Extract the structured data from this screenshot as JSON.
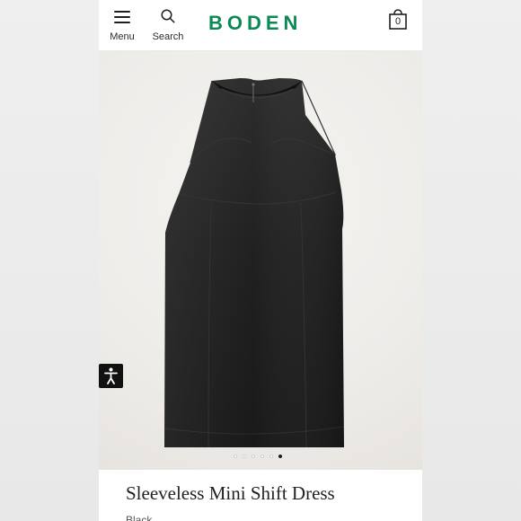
{
  "header": {
    "menu_label": "Menu",
    "search_label": "Search",
    "logo_text": "BODEN",
    "bag_count": "0",
    "brand_color": "#0c8a55"
  },
  "carousel": {
    "dot_count": 6,
    "active_index": 5
  },
  "product": {
    "title": "Sleeveless Mini Shift Dress",
    "color": "Black"
  },
  "icons": {
    "menu": "hamburger-icon",
    "search": "search-icon",
    "bag": "shopping-bag-icon",
    "accessibility": "accessibility-icon"
  }
}
